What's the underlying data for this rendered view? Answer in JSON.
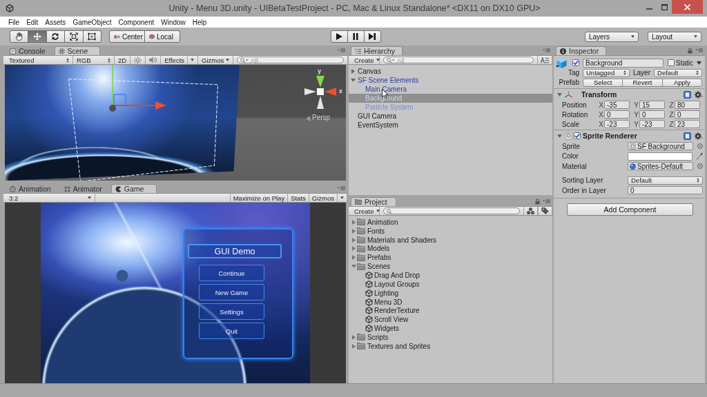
{
  "window": {
    "title": "Unity - Menu 3D.unity - UIBetaTestProject - PC, Mac & Linux Standalone* <DX11 on DX10 GPU>"
  },
  "menu_bar": [
    "File",
    "Edit",
    "Assets",
    "GameObject",
    "Component",
    "Window",
    "Help"
  ],
  "toolbar": {
    "tools": [
      {
        "kind": "hand",
        "selected": false
      },
      {
        "kind": "move",
        "selected": true
      },
      {
        "kind": "rotate",
        "selected": false
      },
      {
        "kind": "scale",
        "selected": false
      },
      {
        "kind": "rect",
        "selected": false
      }
    ],
    "pivot": [
      {
        "kind": "pivot",
        "label": "Center"
      },
      {
        "kind": "space",
        "label": "Local"
      }
    ],
    "playback": [
      {
        "kind": "play"
      },
      {
        "kind": "pause"
      },
      {
        "kind": "step"
      }
    ],
    "layers": "Layers",
    "layout": "Layout"
  },
  "scene_panel": {
    "tabs": [
      {
        "kind": "console",
        "label": "Console",
        "selected": false
      },
      {
        "kind": "scene",
        "label": "Scene",
        "selected": true
      }
    ],
    "toolbar": {
      "draw_mode": "Textured",
      "channel": "RGB",
      "mode_2d": {
        "label": "2D",
        "on": false
      },
      "lighting": {
        "on": false
      },
      "audio": {
        "on": false
      },
      "effects": "Effects",
      "gizmos": "Gizmos",
      "search": {
        "placeholder": "All"
      }
    },
    "view": {
      "axis_y": "y",
      "axis_x": "x",
      "projection": "Persp"
    }
  },
  "game_panel": {
    "tabs": [
      {
        "kind": "animation",
        "label": "Animation",
        "selected": false
      },
      {
        "kind": "animator",
        "label": "Animator",
        "selected": false
      },
      {
        "kind": "game",
        "label": "Game",
        "selected": true
      }
    ],
    "toolbar": {
      "aspect": "3:2",
      "buttons": [
        {
          "label": "Maximize on Play",
          "dropdown": false
        },
        {
          "label": "Stats",
          "dropdown": false
        },
        {
          "label": "Gizmos",
          "dropdown": true
        }
      ]
    },
    "view": {
      "menu_title": "GUI Demo",
      "menu_buttons": [
        "Continue",
        "New Game",
        "Settings",
        "Quit"
      ]
    }
  },
  "hierarchy": {
    "tabs": [
      {
        "kind": "hierarchy",
        "label": "Hierarchy",
        "selected": true
      }
    ],
    "create": "Create",
    "search": {
      "placeholder": "All"
    },
    "items": [
      {
        "label": "Canvas",
        "kind": "group",
        "expanded": false,
        "prefab": false,
        "active": true,
        "selected": false
      },
      {
        "label": "SF Scene Elements",
        "kind": "group",
        "expanded": true,
        "prefab": true,
        "active": true,
        "selected": false,
        "children": [
          {
            "label": "Main Camera",
            "kind": "object",
            "prefab": true,
            "active": true,
            "selected": false
          },
          {
            "label": "Background",
            "kind": "object",
            "prefab": true,
            "active": true,
            "selected": true
          },
          {
            "label": "Particle System",
            "kind": "object",
            "prefab": true,
            "active": false,
            "selected": false
          }
        ]
      },
      {
        "label": "GUI Camera",
        "kind": "object",
        "prefab": false,
        "active": true,
        "selected": false
      },
      {
        "label": "EventSystem",
        "kind": "object",
        "prefab": false,
        "active": true,
        "selected": false
      }
    ]
  },
  "project": {
    "tabs": [
      {
        "kind": "project",
        "label": "Project",
        "selected": true
      }
    ],
    "create": "Create",
    "items": [
      {
        "label": "Animation",
        "kind": "folder",
        "expanded": false
      },
      {
        "label": "Fonts",
        "kind": "folder",
        "expanded": false
      },
      {
        "label": "Materials and Shaders",
        "kind": "folder",
        "expanded": false
      },
      {
        "label": "Models",
        "kind": "folder",
        "expanded": false
      },
      {
        "label": "Prefabs",
        "kind": "folder",
        "expanded": false
      },
      {
        "label": "Scenes",
        "kind": "folder",
        "expanded": true,
        "children": [
          {
            "label": "Drag And Drop",
            "kind": "scene"
          },
          {
            "label": "Layout Groups",
            "kind": "scene"
          },
          {
            "label": "Lighting",
            "kind": "scene"
          },
          {
            "label": "Menu 3D",
            "kind": "scene"
          },
          {
            "label": "RenderTexture",
            "kind": "scene"
          },
          {
            "label": "Scroll View",
            "kind": "scene"
          },
          {
            "label": "Widgets",
            "kind": "scene"
          }
        ]
      },
      {
        "label": "Scripts",
        "kind": "folder",
        "expanded": false
      },
      {
        "label": "Textures and Sprites",
        "kind": "folder",
        "expanded": false
      }
    ]
  },
  "inspector": {
    "tabs": [
      {
        "kind": "inspector",
        "label": "Inspector",
        "selected": true
      }
    ],
    "object": {
      "active": true,
      "name": "Background",
      "static": false,
      "static_label": "Static",
      "tag_label": "Tag",
      "tag": "Untagged",
      "layer_label": "Layer",
      "layer": "Default",
      "prefab_label": "Prefab",
      "prefab_buttons": [
        "Select",
        "Revert",
        "Apply"
      ]
    },
    "components": [
      {
        "kind": "transform",
        "title": "Transform",
        "expanded": true,
        "rows": [
          {
            "label": "Position",
            "values": [
              {
                "axis": "X",
                "value": "-35"
              },
              {
                "axis": "Y",
                "value": "15"
              },
              {
                "axis": "Z",
                "value": "80"
              }
            ]
          },
          {
            "label": "Rotation",
            "values": [
              {
                "axis": "X",
                "value": "0"
              },
              {
                "axis": "Y",
                "value": "0"
              },
              {
                "axis": "Z",
                "value": "0"
              }
            ]
          },
          {
            "label": "Scale",
            "values": [
              {
                "axis": "X",
                "value": "-23"
              },
              {
                "axis": "Y",
                "value": "-23"
              },
              {
                "axis": "Z",
                "value": "23"
              }
            ]
          }
        ]
      },
      {
        "kind": "sprite_renderer",
        "title": "Sprite Renderer",
        "expanded": true,
        "enabled": true,
        "fields": [
          {
            "kind": "sprite",
            "label": "Sprite",
            "value": "SF Background"
          },
          {
            "kind": "color",
            "label": "Color",
            "color": "#ffffff"
          },
          {
            "kind": "material",
            "label": "Material",
            "value": "Sprites-Default"
          },
          {
            "kind": "dropdown",
            "label": "Sorting Layer",
            "value": "Default"
          },
          {
            "kind": "number",
            "label": "Order in Layer",
            "value": "0"
          }
        ]
      }
    ],
    "add_component": "Add Component"
  }
}
